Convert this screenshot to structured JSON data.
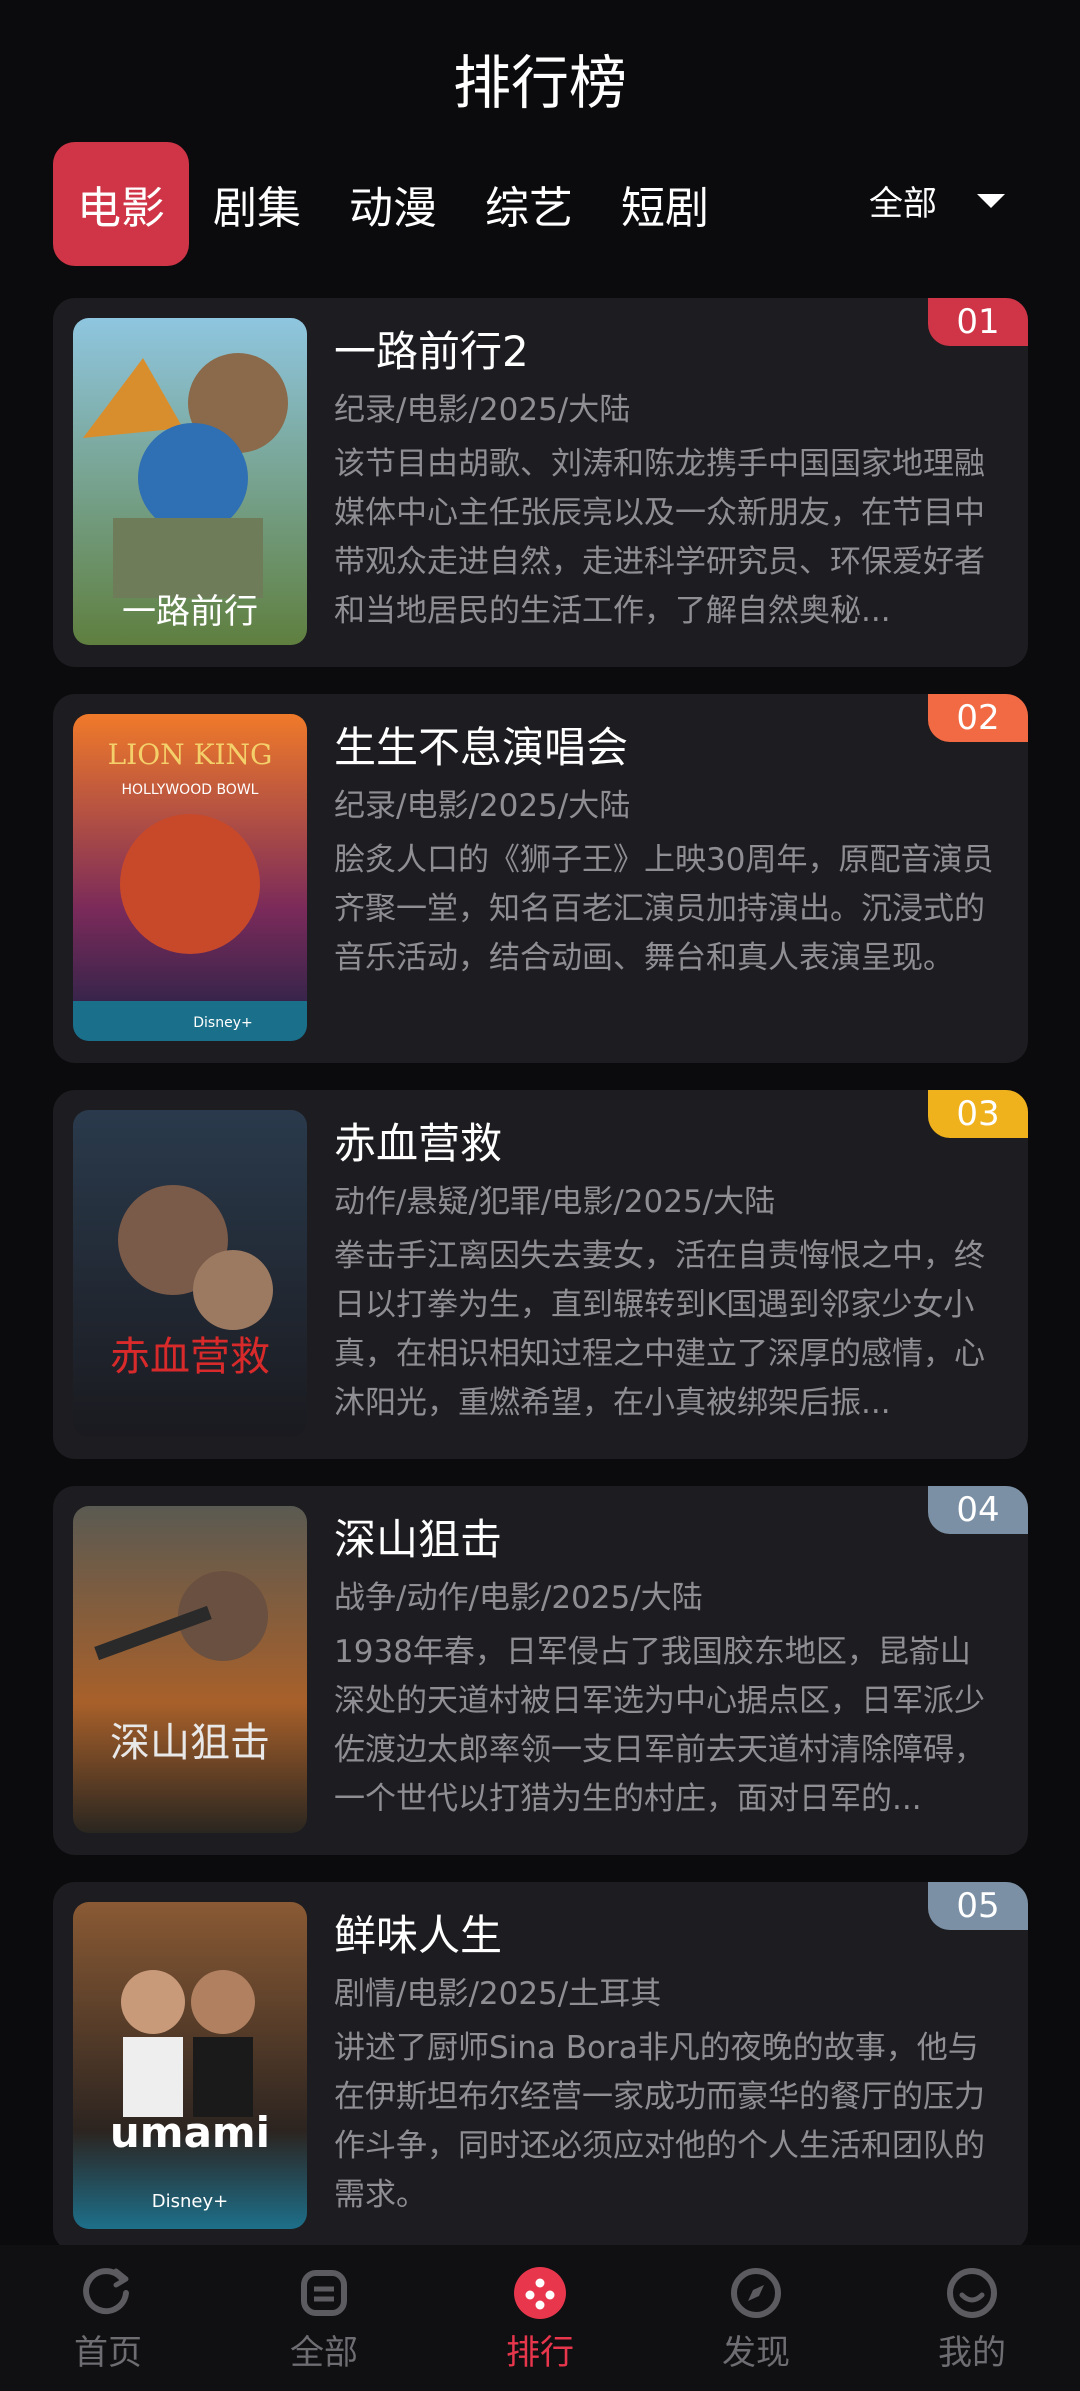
{
  "header": {
    "title": "排行榜"
  },
  "tabs": [
    {
      "label": "电影",
      "active": true
    },
    {
      "label": "剧集",
      "active": false
    },
    {
      "label": "动漫",
      "active": false
    },
    {
      "label": "综艺",
      "active": false
    },
    {
      "label": "短剧",
      "active": false
    }
  ],
  "filter": {
    "label": "全部"
  },
  "items": [
    {
      "rank": "01",
      "rank_color": "#cf3547",
      "title": "一路前行2",
      "meta": "纪录/电影/2025/大陆",
      "desc": "该节目由胡歌、刘涛和陈龙携手中国国家地理融媒体中心主任张辰亮以及一众新朋友，在节目中带观众走进自然，走进科学研究员、环保爱好者和当地居民的生活工作，了解自然奥秘..."
    },
    {
      "rank": "02",
      "rank_color": "#f26a43",
      "title": "生生不息演唱会",
      "meta": "纪录/电影/2025/大陆",
      "desc": "脍炙人口的《狮子王》上映30周年，原配音演员齐聚一堂，知名百老汇演员加持演出。沉浸式的音乐活动，结合动画、舞台和真人表演呈现。"
    },
    {
      "rank": "03",
      "rank_color": "#f0b21c",
      "title": "赤血营救",
      "meta": "动作/悬疑/犯罪/电影/2025/大陆",
      "desc": "拳击手江离因失去妻女，活在自责悔恨之中，终日以打拳为生，直到辗转到K国遇到邻家少女小真，在相识相知过程之中建立了深厚的感情，心沐阳光，重燃希望，在小真被绑架后振..."
    },
    {
      "rank": "04",
      "rank_color": "#7b90a5",
      "title": "深山狙击",
      "meta": "战争/动作/电影/2025/大陆",
      "desc": "1938年春，日军侵占了我国胶东地区，昆嵛山深处的天道村被日军选为中心据点区，日军派少佐渡边太郎率领一支日军前去天道村清除障碍，一个世代以打猎为生的村庄，面对日军的..."
    },
    {
      "rank": "05",
      "rank_color": "#7b90a5",
      "title": "鲜味人生",
      "meta": "剧情/电影/2025/土耳其",
      "desc": "讲述了厨师Sina Bora非凡的夜晚的故事，他与在伊斯坦布尔经营一家成功而豪华的餐厅的压力作斗争，同时还必须应对他的个人生活和团队的需求。"
    }
  ],
  "posters": [
    {
      "caption": "一路前行",
      "colors": [
        "#6db6d8",
        "#c9a44b"
      ]
    },
    {
      "caption": "LION KING",
      "sub": "HOLLYWOOD BOWL",
      "foot": "Disney+",
      "colors": [
        "#e2612a",
        "#2a2a5c"
      ]
    },
    {
      "caption": "赤血营救",
      "colors": [
        "#1e2a38",
        "#5a2a2a"
      ]
    },
    {
      "caption": "深山狙击",
      "colors": [
        "#3c3a30",
        "#b36b2a"
      ]
    },
    {
      "caption": "umami",
      "foot": "Disney+",
      "colors": [
        "#7a4c2c",
        "#1d6f8a"
      ]
    }
  ],
  "bottom_nav": [
    {
      "label": "首页",
      "icon": "home-refresh-icon",
      "active": false
    },
    {
      "label": "全部",
      "icon": "grid-box-icon",
      "active": false
    },
    {
      "label": "排行",
      "icon": "ranking-dice-icon",
      "active": true
    },
    {
      "label": "发现",
      "icon": "compass-icon",
      "active": false
    },
    {
      "label": "我的",
      "icon": "profile-icon",
      "active": false
    }
  ]
}
